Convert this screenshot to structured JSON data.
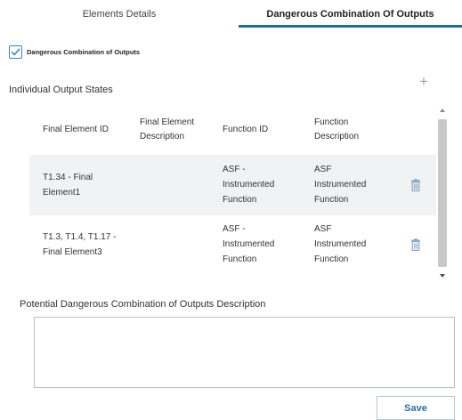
{
  "tabs": [
    {
      "label": "Elements Details",
      "active": false
    },
    {
      "label": "Dangerous Combination Of Outputs",
      "active": true
    }
  ],
  "checkbox": {
    "label": "Dangerous Combination of Outputs",
    "checked": true
  },
  "section": {
    "title": "Individual Output States",
    "add_icon": "plus-icon"
  },
  "table": {
    "headers": {
      "final_element_id": "Final Element ID",
      "final_element_description_1": "Final Element",
      "final_element_description_2": "Description",
      "function_id": "Function ID",
      "function_description_1": "Function",
      "function_description_2": "Description"
    },
    "rows": [
      {
        "final_element_id_1": "T1.34 - Final",
        "final_element_id_2": "Element1",
        "final_element_description": "",
        "function_id_1": "ASF -",
        "function_id_2": "Instrumented",
        "function_id_3": "Function",
        "function_description_1": "ASF",
        "function_description_2": "Instrumented",
        "function_description_3": "Function",
        "action_icon": "trash-icon"
      },
      {
        "final_element_id_1": "T1.3, T1.4, T1.17 -",
        "final_element_id_2": "Final Element3",
        "final_element_description": "",
        "function_id_1": "ASF -",
        "function_id_2": "Instrumented",
        "function_id_3": "Function",
        "function_description_1": "ASF",
        "function_description_2": "Instrumented",
        "function_description_3": "Function",
        "action_icon": "trash-icon"
      }
    ]
  },
  "description": {
    "label": "Potential Dangerous Combination of Outputs Description",
    "value": ""
  },
  "actions": {
    "save_label": "Save"
  },
  "colors": {
    "accent": "#1f6f8b",
    "checkbox": "#3b82c4",
    "icon": "#7fa3c4",
    "button_text": "#2d6ea3"
  }
}
